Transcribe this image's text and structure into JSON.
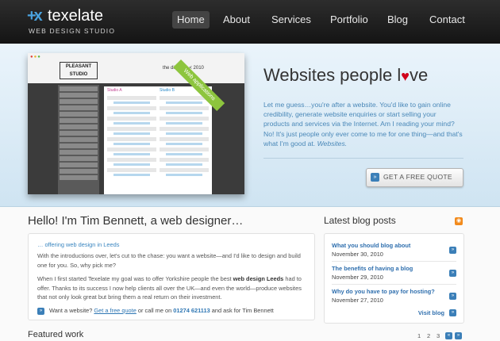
{
  "header": {
    "logo_mark": "+x",
    "logo_name": "texelate",
    "logo_tagline": "WEB DESIGN STUDIO",
    "nav": [
      "Home",
      "About",
      "Services",
      "Portfolio",
      "Blog",
      "Contact"
    ],
    "active_nav": "Home"
  },
  "hero": {
    "screenshot": {
      "logo": "PLEASANT STUDIO",
      "diary": "the diary for < 2010",
      "col_a": "Studio A",
      "col_b": "Studio B",
      "ribbon": "Web applications"
    },
    "title_before": "Websites people l",
    "title_after": "ve",
    "heart_icon": "heart-icon",
    "text": "Let me guess…you're after a website. You'd like to gain online credibility, generate website enquiries or start selling your products and services via the Internet. Am I reading your mind? No! It's just people only ever come to me for one thing—and that's what I'm good at.",
    "text_em": "Websites.",
    "quote_button": "GET A FREE QUOTE"
  },
  "intro": {
    "title": "Hello! I'm Tim Bennett, a web designer…",
    "subtitle": "… offering web design in Leeds",
    "p1": "With the introductions over, let's cut to the chase: you want a website—and I'd like to design and build one for you. So, why pick me?",
    "p2_start": "When I first started Texelate my goal was to offer Yorkshire people the best ",
    "p2_strong": "web design Leeds",
    "p2_end": " had to offer. Thanks to its success I now help clients all over the UK—and even the world—produce websites that not only look great but bring them a real return on their investment.",
    "want_1": "Want a website? ",
    "want_link": "Get a free quote",
    "want_2": " or call me on ",
    "want_phone": "01274 621113",
    "want_3": " and ask for Tim Bennett"
  },
  "blog": {
    "title": "Latest blog posts",
    "posts": [
      {
        "title": "What you should blog about",
        "date": "November 30, 2010"
      },
      {
        "title": "The benefits of having a blog",
        "date": "November 29, 2010"
      },
      {
        "title": "Why do you have to pay for hosting?",
        "date": "November 27, 2010"
      }
    ],
    "visit": "Visit blog"
  },
  "featured": {
    "title": "Featured work",
    "pages": [
      "1",
      "2",
      "3"
    ]
  },
  "colors": {
    "accent": "#3b7fb8",
    "link": "#2f6fae",
    "header": "#1a1a1a",
    "hero_bg": "#dcecf7",
    "ribbon": "#8dc53e",
    "rss": "#f28a1c"
  }
}
